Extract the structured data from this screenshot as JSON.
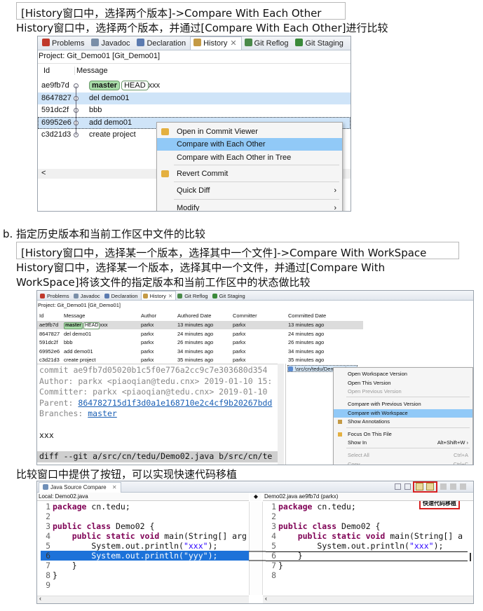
{
  "section1": {
    "code": "[History窗口中，选择两个版本]->Compare With Each Other",
    "desc": "History窗口中，选择两个版本，并通过[Compare With Each Other]进行比较",
    "tabs": [
      {
        "label": "Problems",
        "icon": "problems-icon",
        "color": "#c0392b"
      },
      {
        "label": "Javadoc",
        "icon": "javadoc-icon",
        "color": "#7a8fa8"
      },
      {
        "label": "Declaration",
        "icon": "declaration-icon",
        "color": "#5b7bb0"
      },
      {
        "label": "History",
        "icon": "history-icon",
        "color": "#c49a45"
      },
      {
        "label": "Git Reflog",
        "icon": "git-reflog-icon",
        "color": "#4a8a4a"
      },
      {
        "label": "Git Staging",
        "icon": "git-staging-icon",
        "color": "#3a8a3a"
      }
    ],
    "tab_close": "✕",
    "project": "Project: Git_Demo01 [Git_Demo01]",
    "col_id": "Id",
    "col_message": "Message",
    "rows": [
      {
        "id": "ae9fb7d",
        "branch": "master",
        "head": "HEAD",
        "message": "xxx"
      },
      {
        "id": "8647827",
        "message": "del demo01"
      },
      {
        "id": "591dc2f",
        "message": "bbb"
      },
      {
        "id": "69952e6",
        "message": "add demo01"
      },
      {
        "id": "c3d21d3",
        "message": "create project"
      }
    ],
    "scroll_left": "<",
    "menu": [
      {
        "label": "Open in Commit Viewer",
        "icon": "commit-viewer-icon"
      },
      {
        "label": "Compare with Each Other",
        "highlight": true
      },
      {
        "label": "Compare with Each Other in Tree"
      },
      {
        "label": "Revert Commit",
        "icon": "revert-icon"
      },
      {
        "label": "Quick Diff",
        "arrow": "›"
      },
      {
        "label": "Modify",
        "arrow": "›"
      }
    ]
  },
  "section2": {
    "heading": "b.  指定历史版本和当前工作区中文件的比较",
    "code": "[History窗口中，选择某一个版本，选择其中一个文件]->Compare With WorkSpace",
    "desc_line1": "History窗口中，选择某一个版本，选择其中一个文件，并通过[Compare With",
    "desc_line2": "WorkSpace]将该文件的指定版本和当前工作区中的状态做比较",
    "project": "Project: Git_Demo01 [Git_Demo01]",
    "cols": [
      "Id",
      "Message",
      "Author",
      "Authored Date",
      "Committer",
      "Committed Date"
    ],
    "rows": [
      {
        "id": "ae9fb7d",
        "branch": "master",
        "head": "HEAD",
        "message": "xxx",
        "author": "parkx",
        "adate": "13 minutes ago",
        "committer": "parkx",
        "cdate": "13 minutes ago"
      },
      {
        "id": "8647827",
        "message": "del demo01",
        "author": "parkx",
        "adate": "24 minutes ago",
        "committer": "parkx",
        "cdate": "24 minutes ago"
      },
      {
        "id": "591dc2f",
        "message": "bbb",
        "author": "parkx",
        "adate": "26 minutes ago",
        "committer": "parkx",
        "cdate": "26 minutes ago"
      },
      {
        "id": "69952e6",
        "message": "add demo01",
        "author": "parkx",
        "adate": "34 minutes ago",
        "committer": "parkx",
        "cdate": "34 minutes ago"
      },
      {
        "id": "c3d21d3",
        "message": "create project",
        "author": "parkx",
        "adate": "35 minutes ago",
        "committer": "parkx",
        "cdate": "35 minutes ago"
      }
    ],
    "commit_lines": {
      "commit": "commit ae9fb7d05020b1c5f0e776a2cc9c7e303680d354",
      "author": "Author: parkx <piaoqian@tedu.cnx> 2019-01-10 15:",
      "committer": "Committer: parkx <piaoqian@tedu.cnx> 2019-01-10",
      "parent_label": "Parent: ",
      "parent_link": "864782715d1f3d0a1e168710e2c4cf9b20267bdd",
      "branches_label": "Branches: ",
      "branches_link": "master",
      "message": "xxx",
      "diff": "diff --git a/src/cn/tedu/Demo02.java b/src/cn/te"
    },
    "file_item": "\\src/cn/tedu/Demo02.java",
    "menu": [
      {
        "label": "Open Workspace Version"
      },
      {
        "label": "Open This Version"
      },
      {
        "label": "Open Previous Version",
        "disabled": true
      },
      {
        "label": "Compare with Previous Version"
      },
      {
        "label": "Compare with Workspace",
        "highlight": true
      },
      {
        "label": "Show Annotations"
      },
      {
        "label": "Focus On This File"
      },
      {
        "label": "Show In",
        "shortcut": "Alt+Shift+W ›"
      },
      {
        "label": "Select All",
        "shortcut": "Ctrl+A",
        "disabled": true
      },
      {
        "label": "Copy",
        "shortcut": "Ctrl+C",
        "disabled": true
      }
    ]
  },
  "section3": {
    "desc": "比较窗口中提供了按钮，可以实现快速代码移植",
    "title": "Java Source Compare",
    "title_close": "✕",
    "tooltip": "快速代码移植",
    "left_title": "Local: Demo02.java",
    "right_title": "Demo02.java ae9fb7d (parkx)",
    "left_lines": [
      {
        "n": "1",
        "kw": "package",
        "text": " cn.tedu;"
      },
      {
        "n": "2",
        "text": ""
      },
      {
        "n": "3",
        "kw": "public class",
        "text": " Demo02 {"
      },
      {
        "n": "4",
        "indent": "    ",
        "kw": "public static void",
        "text": " main(String[] arg"
      },
      {
        "n": "5",
        "indent": "        ",
        "text": "System.out.println(",
        "str": "\"xxx\"",
        "tail": ");"
      },
      {
        "n": "6",
        "indent": "        ",
        "text": "System.out.println(",
        "str": "\"yyy\"",
        "tail": ");",
        "highlight": true
      },
      {
        "n": "7",
        "indent": "    ",
        "text": "}"
      },
      {
        "n": "8",
        "text": "}"
      },
      {
        "n": "9",
        "text": ""
      }
    ],
    "right_lines": [
      {
        "n": "1",
        "kw": "package",
        "text": " cn.tedu;"
      },
      {
        "n": "2",
        "text": ""
      },
      {
        "n": "3",
        "kw": "public class",
        "text": " Demo02 {"
      },
      {
        "n": "4",
        "indent": "    ",
        "kw": "public static void",
        "text": " main(String[] a"
      },
      {
        "n": "5",
        "indent": "        ",
        "text": "System.out.println(",
        "str": "\"xxx\"",
        "tail": ");"
      },
      {
        "n": "6",
        "indent": "    ",
        "text": "}"
      },
      {
        "n": "7",
        "text": "}"
      },
      {
        "n": "8",
        "text": ""
      }
    ]
  }
}
